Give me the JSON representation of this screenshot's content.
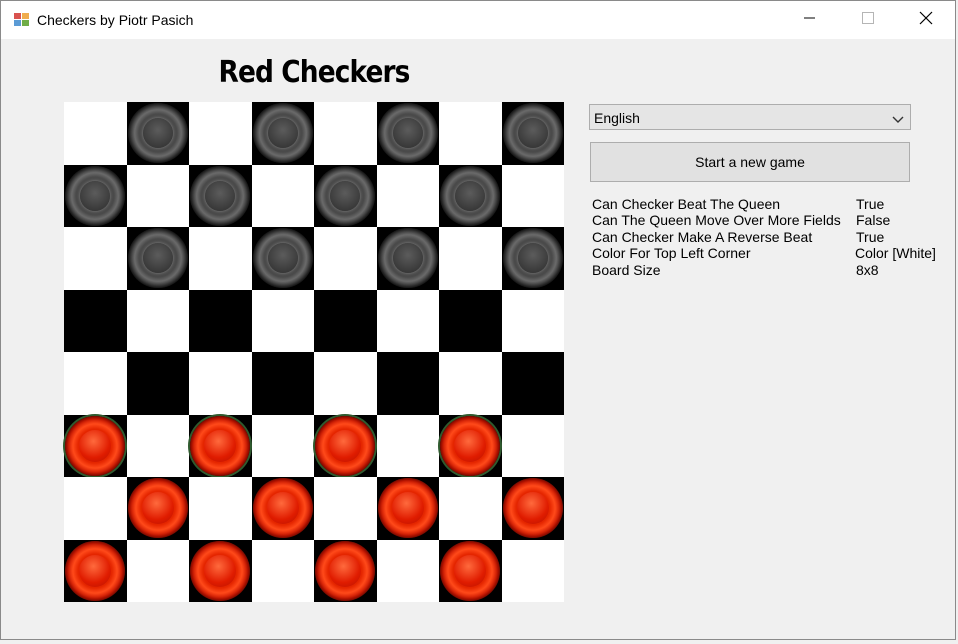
{
  "window": {
    "title": "Checkers by Piotr Pasich",
    "controls": {
      "minimize": "minimize-icon",
      "maximize": "maximize-icon",
      "close": "close-icon"
    }
  },
  "board": {
    "title": "Red Checkers",
    "size": 8,
    "light_color": "#ffffff",
    "dark_color": "#000000",
    "pieces": {
      "dark": [
        [
          0,
          1
        ],
        [
          0,
          3
        ],
        [
          0,
          5
        ],
        [
          0,
          7
        ],
        [
          1,
          0
        ],
        [
          1,
          2
        ],
        [
          1,
          4
        ],
        [
          1,
          6
        ],
        [
          2,
          1
        ],
        [
          2,
          3
        ],
        [
          2,
          5
        ],
        [
          2,
          7
        ]
      ],
      "red": [
        [
          5,
          0
        ],
        [
          5,
          2
        ],
        [
          5,
          4
        ],
        [
          5,
          6
        ],
        [
          6,
          1
        ],
        [
          6,
          3
        ],
        [
          6,
          5
        ],
        [
          6,
          7
        ],
        [
          7,
          0
        ],
        [
          7,
          2
        ],
        [
          7,
          4
        ],
        [
          7,
          6
        ]
      ]
    }
  },
  "controls": {
    "language": "English",
    "new_game_label": "Start a new game"
  },
  "settings": [
    {
      "label": "Can Checker Beat The Queen",
      "value": "True"
    },
    {
      "label": "Can The Queen Move Over More Fields",
      "value": "False"
    },
    {
      "label": "Can Checker Make A Reverse Beat",
      "value": "True"
    },
    {
      "label": "Color For Top Left Corner",
      "value": "Color [White]"
    },
    {
      "label": "Board Size",
      "value": "8x8"
    }
  ]
}
